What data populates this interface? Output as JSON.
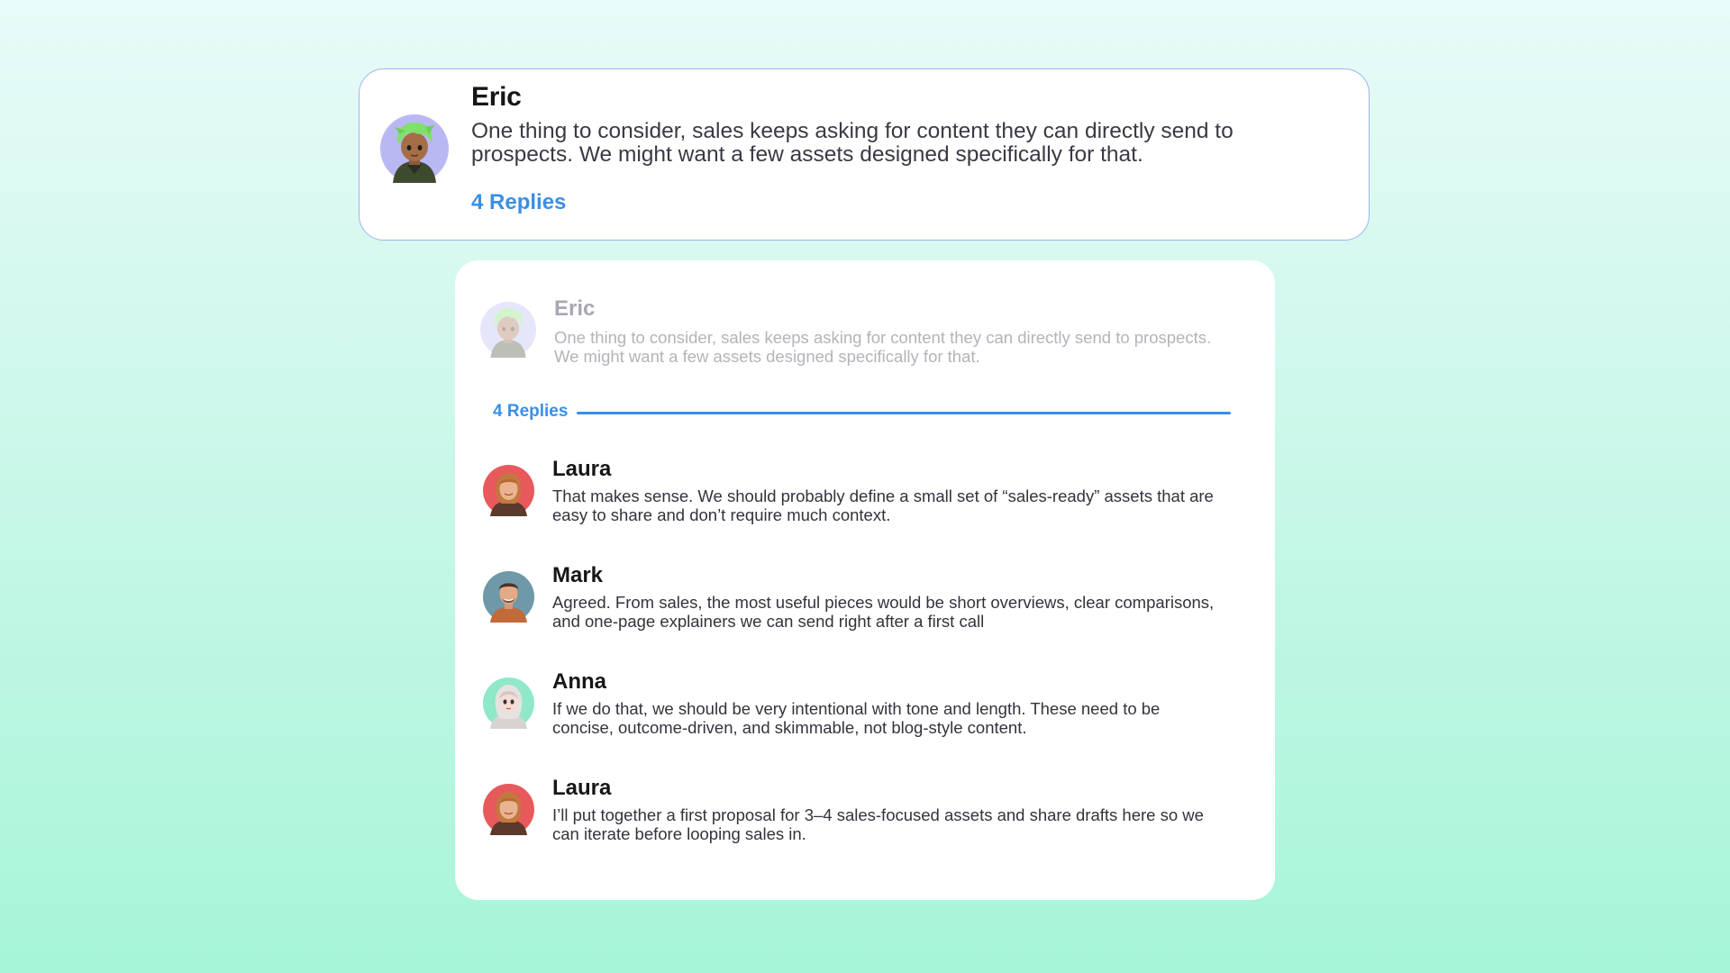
{
  "post": {
    "author": "Eric",
    "avatar_icon": "eric-avatar-icon",
    "message": "One thing to consider, sales keeps asking for content they can directly send to prospects. We might want a few assets designed specifically for that.",
    "replies_link": "4 Replies"
  },
  "thread": {
    "parent": {
      "author": "Eric",
      "message": "One thing to consider, sales keeps asking for content they can directly send to prospects. We might want a few assets designed specifically for that."
    },
    "replies_count": "4 Replies",
    "replies": [
      {
        "author": "Laura",
        "avatar_icon": "laura-avatar-icon",
        "message": "That makes sense. We should probably define a small set of “sales-ready” assets that are easy to share and don’t require much context."
      },
      {
        "author": "Mark",
        "avatar_icon": "mark-avatar-icon",
        "message": "Agreed. From sales, the most useful pieces would be short overviews, clear comparisons, and one-page explainers we can send right after a first call"
      },
      {
        "author": "Anna",
        "avatar_icon": "anna-avatar-icon",
        "message": "If we do that, we should be very intentional with tone and length. These need to be concise, outcome-driven, and skimmable, not blog-style content."
      },
      {
        "author": "Laura",
        "avatar_icon": "laura-avatar-icon",
        "message": "I’ll put together a first proposal for 3–4 sales-focused assets and share drafts here so we can iterate before looping sales in."
      }
    ]
  },
  "colors": {
    "accent": "#3a8fe6",
    "card_border": "#9eb3f2",
    "background_top": "#e8fbf8",
    "background_bottom": "#a6f5d8"
  }
}
